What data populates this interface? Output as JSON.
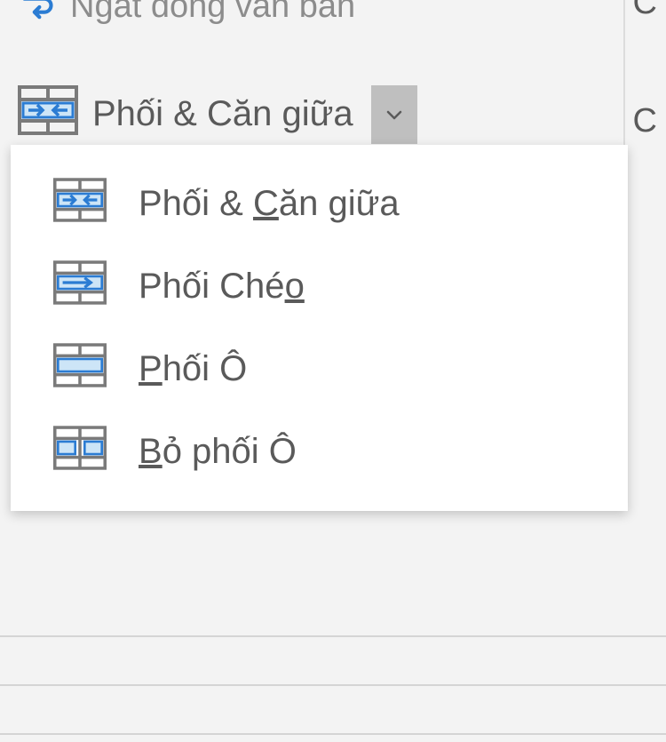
{
  "topbar": {
    "wrap_text_label": "Ngắt dòng văn bản"
  },
  "merge_button": {
    "label": "Phối & Căn giữa"
  },
  "dropdown": {
    "items": [
      {
        "label_pre": "Phối & ",
        "accel": "C",
        "label_post": "ăn giữa"
      },
      {
        "label_pre": "Phối Ché",
        "accel": "o",
        "label_post": ""
      },
      {
        "label_pre": "",
        "accel": "P",
        "label_post": "hối Ô"
      },
      {
        "label_pre": "",
        "accel": "B",
        "label_post": "ỏ phối Ô"
      }
    ]
  },
  "right_edge": {
    "snip_top": "C",
    "snip_mid": "C"
  }
}
